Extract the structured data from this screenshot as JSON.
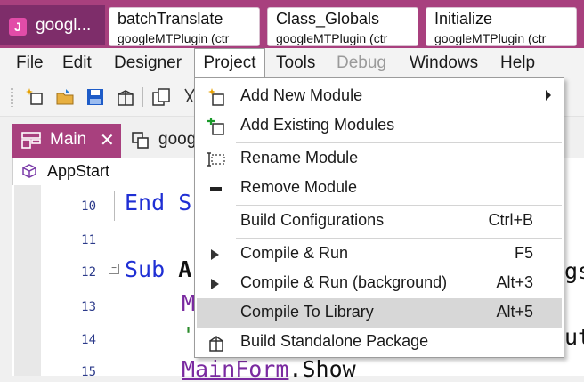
{
  "app": {
    "tab_label": "googl...",
    "logo_letter": "J",
    "doc_tabs": [
      {
        "title": "batchTranslate",
        "subtitle": "googleMTPlugin (ctr"
      },
      {
        "title": "Class_Globals",
        "subtitle": "googleMTPlugin (ctr"
      },
      {
        "title": "Initialize",
        "subtitle": "googleMTPlugin (ctr"
      }
    ]
  },
  "menubar": {
    "items": [
      "File",
      "Edit",
      "Designer",
      "Project",
      "Tools",
      "Debug",
      "Windows",
      "Help"
    ],
    "active": "Project",
    "disabled": [
      "Debug"
    ]
  },
  "editor_tabs": {
    "main_label": "Main",
    "second_label": "goog"
  },
  "module_selector": {
    "value": "AppStart"
  },
  "code": {
    "lines": [
      {
        "num": "10",
        "text": "End S"
      },
      {
        "num": "11",
        "text": ""
      },
      {
        "num": "12",
        "text_kw": "Sub",
        "text_rest": "A"
      },
      {
        "num": "13",
        "text": "M"
      },
      {
        "num": "14",
        "text": "'"
      },
      {
        "num": "15",
        "text_a": "MainForm",
        "text_b": ".Show"
      }
    ],
    "right_fragments": {
      "line12": "gs",
      "line14": "ut"
    }
  },
  "project_menu": {
    "items": [
      {
        "label": "Add New Module",
        "icon": "add-new-module-icon",
        "shortcut": "",
        "submenu": true
      },
      {
        "label": "Add Existing Modules",
        "icon": "add-existing-modules-icon",
        "shortcut": ""
      },
      {
        "label": "Rename Module",
        "icon": "rename-module-icon",
        "shortcut": ""
      },
      {
        "label": "Remove Module",
        "icon": "remove-module-icon",
        "shortcut": ""
      },
      {
        "label": "Build Configurations",
        "icon": "",
        "shortcut": "Ctrl+B"
      },
      {
        "label": "Compile & Run",
        "icon": "play-icon",
        "shortcut": "F5"
      },
      {
        "label": "Compile & Run (background)",
        "icon": "play-icon",
        "shortcut": "Alt+3"
      },
      {
        "label": "Compile To Library",
        "icon": "",
        "shortcut": "Alt+5",
        "highlighted": true
      },
      {
        "label": "Build Standalone Package",
        "icon": "package-icon",
        "shortcut": ""
      }
    ]
  },
  "colors": {
    "accent": "#a8407e",
    "accent_dark": "#7e2d6a",
    "keyword": "#1f2fd4",
    "line_number": "#2b3a8a",
    "menu_hover": "#d7d7d7"
  }
}
